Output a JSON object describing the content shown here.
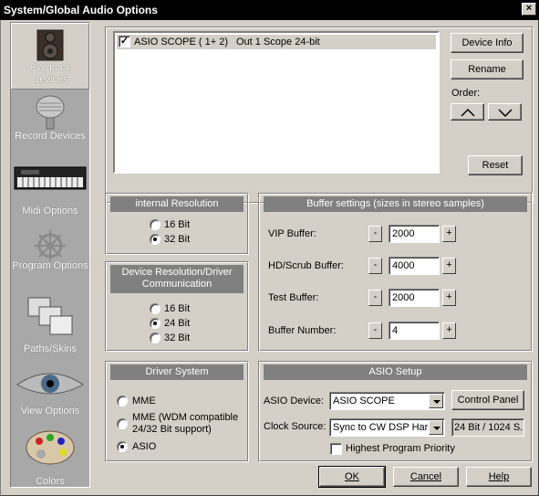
{
  "window": {
    "title": "System/Global Audio Options",
    "close_glyph": "×"
  },
  "sidebar": {
    "items": [
      {
        "label": "Playback Devices",
        "icon": "speaker-icon"
      },
      {
        "label": "Record Devices",
        "icon": "microphone-icon"
      },
      {
        "label": "Midi Options",
        "icon": "keyboard-icon"
      },
      {
        "label": "Program Options",
        "icon": "ship-wheel-icon"
      },
      {
        "label": "Paths/Skins",
        "icon": "folders-icon"
      },
      {
        "label": "View Options",
        "icon": "eye-icon"
      },
      {
        "label": "Colors",
        "icon": "palette-icon"
      }
    ]
  },
  "devices": {
    "rows": [
      {
        "checked": true,
        "name": "ASIO SCOPE ( 1+ 2)",
        "desc": "Out 1 Scope 24-bit"
      }
    ],
    "device_info": "Device Info",
    "rename": "Rename",
    "order_label": "Order:",
    "reset": "Reset"
  },
  "internal_resolution": {
    "title": "internal Resolution",
    "options": [
      "16 Bit",
      "32 Bit"
    ],
    "selected": "32 Bit"
  },
  "device_resolution": {
    "title": "Device Resolution/Driver Communication",
    "options": [
      "16 Bit",
      "24 Bit",
      "32 Bit"
    ],
    "selected": "24 Bit"
  },
  "driver_system": {
    "title": "Driver System",
    "options": [
      "MME",
      "MME (WDM compatible 24/32 Bit support)",
      "ASIO"
    ],
    "selected": "ASIO"
  },
  "buffer": {
    "title": "Buffer settings (sizes in stereo samples)",
    "rows": [
      {
        "label": "VIP Buffer:",
        "value": "2000"
      },
      {
        "label": "HD/Scrub Buffer:",
        "value": "4000"
      },
      {
        "label": "Test Buffer:",
        "value": "2000"
      },
      {
        "label": "Buffer Number:",
        "value": "4"
      }
    ],
    "minus": "-",
    "plus": "+"
  },
  "asio": {
    "title": "ASIO Setup",
    "device_label": "ASIO Device:",
    "device_value": "ASIO SCOPE",
    "control_panel": "Control Panel",
    "clock_label": "Clock Source:",
    "clock_value": "Sync to CW DSP Hard",
    "format": "24 Bit / 1024 S.",
    "priority_label": "Highest Program Priority",
    "priority_checked": false
  },
  "footer": {
    "ok": "OK",
    "cancel": "Cancel",
    "help": "Help"
  },
  "colors": {
    "sidebar_bg": "#a8a8a8",
    "panel_title": "#808080",
    "face": "#d4d0c8"
  }
}
